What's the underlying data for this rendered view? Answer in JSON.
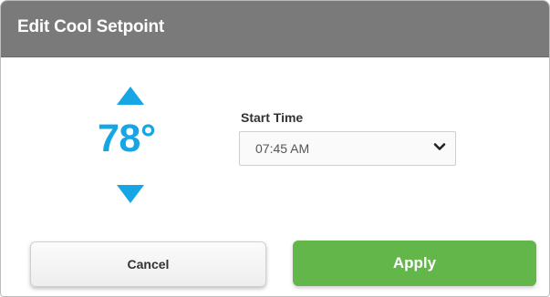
{
  "dialog": {
    "title": "Edit Cool Setpoint"
  },
  "setpoint": {
    "value": "78°",
    "increase_icon": "arrow-up-triangle",
    "decrease_icon": "arrow-down-triangle"
  },
  "start_time": {
    "label": "Start Time",
    "selected": "07:45 AM",
    "dropdown_icon": "chevron-down"
  },
  "buttons": {
    "cancel_label": "Cancel",
    "apply_label": "Apply"
  },
  "colors": {
    "accent": "#17a6e4",
    "titlebar": "#7a7a7a",
    "apply": "#62b64a"
  }
}
